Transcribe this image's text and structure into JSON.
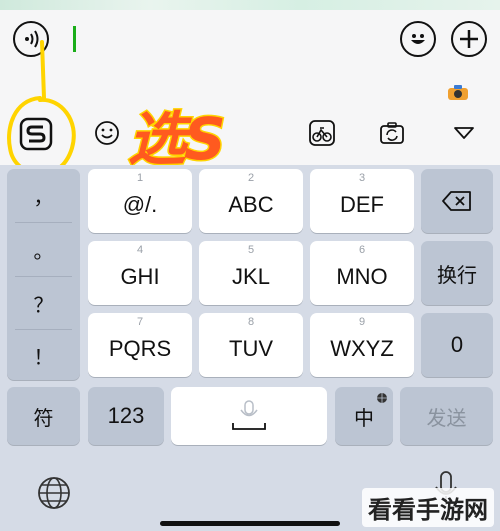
{
  "input_bar": {
    "voice_icon": "voice-wave-icon",
    "emoji_icon": "smiley-face-icon",
    "add_icon": "plus-icon"
  },
  "toolbar": {
    "items": [
      "sogou-logo-icon",
      "emoji-icon",
      "shop-icon",
      "cycle-icon",
      "screenshot-icon",
      "collapse-triangle-icon"
    ]
  },
  "annotation": {
    "text": "选S",
    "color": "#ff5a1f",
    "outline": "#ffd400"
  },
  "keyboard": {
    "side_symbols": [
      "，",
      "。",
      "？",
      "！"
    ],
    "rows": [
      [
        {
          "num": "1",
          "label": "@/."
        },
        {
          "num": "2",
          "label": "ABC"
        },
        {
          "num": "3",
          "label": "DEF"
        }
      ],
      [
        {
          "num": "4",
          "label": "GHI"
        },
        {
          "num": "5",
          "label": "JKL"
        },
        {
          "num": "6",
          "label": "MNO"
        }
      ],
      [
        {
          "num": "7",
          "label": "PQRS"
        },
        {
          "num": "8",
          "label": "TUV"
        },
        {
          "num": "9",
          "label": "WXYZ"
        }
      ]
    ],
    "newline_label": "换行",
    "zero_label": "0",
    "symbol_label": "符",
    "numeric_label": "123",
    "lang_label": "中",
    "send_label": "发送"
  },
  "bottom": {
    "globe_icon": "globe-icon",
    "mic_icon": "microphone-icon"
  },
  "watermark": "看看手游网",
  "colors": {
    "keyboard_bg": "#d5dbe6",
    "dark_key": "#bcc5d3",
    "cursor": "#1aad19"
  }
}
